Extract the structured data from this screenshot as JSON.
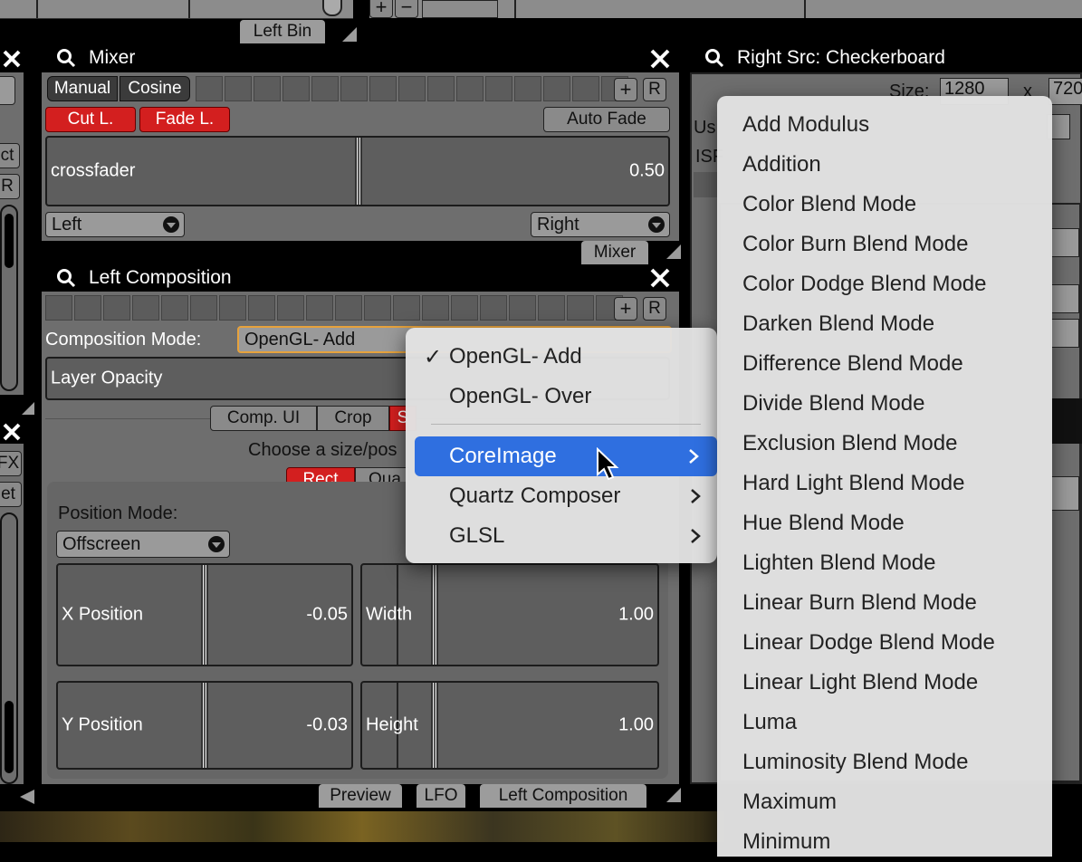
{
  "left_bin": {
    "tab": "Left Bin"
  },
  "mixer": {
    "title": "Mixer",
    "tabs": [
      "Manual",
      "Cosine"
    ],
    "cut_label": "Cut L.",
    "fade_label": "Fade L.",
    "auto_fade_label": "Auto Fade",
    "add_label": "+",
    "reset_label": "R",
    "crossfader": {
      "label": "crossfader",
      "value": "0.50",
      "fraction": 0.5
    },
    "left_select": "Left",
    "right_select": "Right",
    "footer_tab": "Mixer"
  },
  "left_composition": {
    "title": "Left Composition",
    "add_label": "+",
    "reset_label": "R",
    "comp_mode_label": "Composition Mode:",
    "comp_mode_value": "OpenGL- Add",
    "layer_opacity_label": "Layer Opacity",
    "seg_comp_ui": "Comp. UI",
    "seg_crop": "Crop",
    "seg_s": "S",
    "choose_text": "Choose a size/pos",
    "rect_label": "Rect",
    "qua_label": "Qua",
    "position_mode_label": "Position Mode:",
    "position_mode_value": "Offscreen",
    "x_position": {
      "label": "X Position",
      "value": "-0.05"
    },
    "width": {
      "label": "Width",
      "value": "1.00"
    },
    "y_position": {
      "label": "Y Position",
      "value": "-0.03"
    },
    "height": {
      "label": "Height",
      "value": "1.00"
    }
  },
  "bottom_tabs": [
    "Preview",
    "LFO",
    "Left Composition"
  ],
  "right_src": {
    "title": "Right Src: Checkerboard",
    "size_label": "Size:",
    "size_w": "1280",
    "size_x": "x",
    "size_h": "720",
    "us_text": "Us",
    "isf_text": "ISF"
  },
  "left_strip": {
    "ct": "ct",
    "r": "R",
    "fx": "FX",
    "et": "et"
  },
  "mode_menu": {
    "items": [
      {
        "label": "OpenGL- Add",
        "checked": true,
        "submenu": false
      },
      {
        "label": "OpenGL- Over",
        "checked": false,
        "submenu": false
      },
      {
        "label": "CoreImage",
        "checked": false,
        "submenu": true,
        "highlighted": true
      },
      {
        "label": "Quartz Composer",
        "checked": false,
        "submenu": true
      },
      {
        "label": "GLSL",
        "checked": false,
        "submenu": true
      }
    ],
    "check_mark": "✓"
  },
  "coreimage_submenu": {
    "items": [
      "Add Modulus",
      "Addition",
      "Color Blend Mode",
      "Color Burn Blend Mode",
      "Color Dodge Blend Mode",
      "Darken Blend Mode",
      "Difference Blend Mode",
      "Divide Blend Mode",
      "Exclusion Blend Mode",
      "Hard Light Blend Mode",
      "Hue Blend Mode",
      "Lighten Blend Mode",
      "Linear Burn Blend Mode",
      "Linear Dodge Blend Mode",
      "Linear Light Blend Mode",
      "Luma",
      "Luminosity Blend Mode",
      "Maximum",
      "Minimum"
    ]
  },
  "colors": {
    "accent_red": "#d31f1f",
    "menu_highlight": "#2f6fe0",
    "panel": "#6e6e6e"
  }
}
